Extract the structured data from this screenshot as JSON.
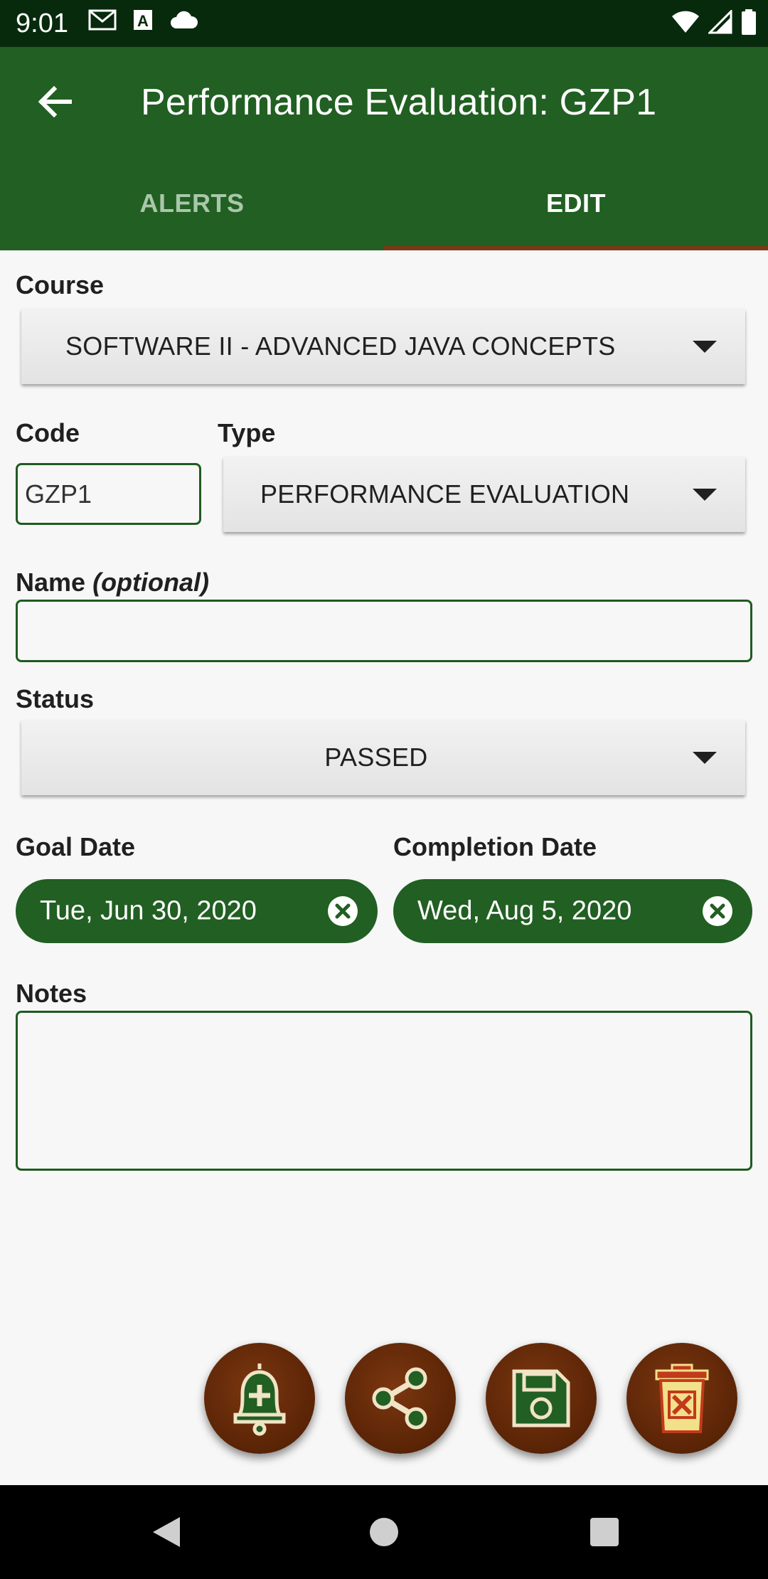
{
  "status_bar": {
    "time": "9:01",
    "left_icons": [
      "gmail-icon",
      "font-a-icon",
      "cloud-icon"
    ],
    "right_icons": [
      "wifi-icon",
      "signal-icon",
      "battery-icon"
    ]
  },
  "app_bar": {
    "title": "Performance Evaluation: GZP1",
    "back_icon": "arrow-back-icon"
  },
  "tabs": [
    {
      "label": "ALERTS",
      "active": false
    },
    {
      "label": "EDIT",
      "active": true
    }
  ],
  "form": {
    "course_label": "Course",
    "course_value": "SOFTWARE II - ADVANCED JAVA CONCEPTS",
    "code_label": "Code",
    "code_value": "GZP1",
    "type_label": "Type",
    "type_value": "PERFORMANCE EVALUATION",
    "name_label": "Name",
    "name_label_suffix": "(optional)",
    "name_value": "",
    "status_label": "Status",
    "status_value": "PASSED",
    "goal_date_label": "Goal Date",
    "goal_date_value": "Tue, Jun 30, 2020",
    "completion_date_label": "Completion Date",
    "completion_date_value": "Wed, Aug 5, 2020",
    "notes_label": "Notes",
    "notes_value": ""
  },
  "fabs": [
    "add-alert-icon",
    "share-icon",
    "save-icon",
    "delete-icon"
  ],
  "colors": {
    "primary": "#215f22",
    "status_bar": "#072a0c",
    "accent": "#7a3a16",
    "fab": "#5a2406",
    "background": "#f7f7f7"
  },
  "nav_bar": [
    "back-triangle-icon",
    "home-circle-icon",
    "recents-square-icon"
  ]
}
